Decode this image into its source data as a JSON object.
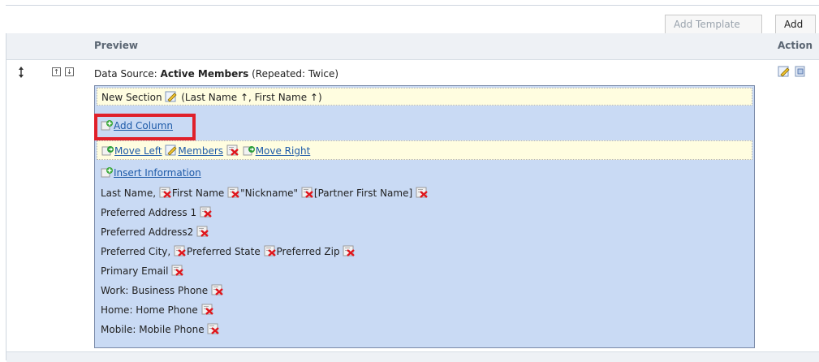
{
  "toolbar": {
    "add_template": "Add Template",
    "add": "Add"
  },
  "columns": {
    "preview": "Preview",
    "action": "Action"
  },
  "row": {
    "ds_prefix": "Data Source: ",
    "ds_name": "Active Members",
    "ds_suffix": " (Repeated: Twice)"
  },
  "section": {
    "title": "New Section",
    "sort": "(Last Name ↑, First Name ↑)",
    "add_column": "Add Column",
    "move_left": "Move Left",
    "members": "Members",
    "move_right": "Move Right",
    "insert_info": "Insert Information"
  },
  "fields": {
    "l1a": "Last Name, ",
    "l1b": "First Name ",
    "l1c": "\"Nickname\" ",
    "l1d": "[Partner First Name] ",
    "l2": "Preferred Address 1 ",
    "l3": "Preferred Address2 ",
    "l4a": "Preferred City, ",
    "l4b": "Preferred State ",
    "l4c": "Preferred Zip ",
    "l5": "Primary Email ",
    "l6": "Work: Business Phone ",
    "l7": "Home: Home Phone ",
    "l8": "Mobile: Mobile Phone "
  },
  "icons": {
    "edit": "pencil-edit-icon",
    "delete": "red-x-delete-icon",
    "add": "green-plus-icon",
    "arrow": "green-arrow-icon",
    "copy": "copy-icon",
    "sort": "sort-handle-icon"
  },
  "colors": {
    "panel": "#c9daf4",
    "highlight": "#e0202a",
    "link": "#1d5aa8"
  }
}
